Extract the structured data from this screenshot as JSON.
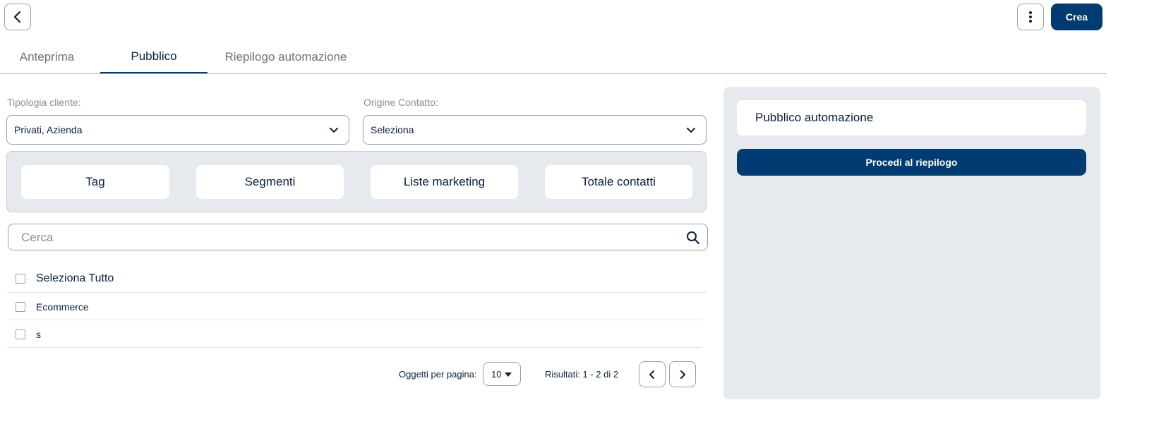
{
  "header": {
    "back_icon": "chevron-left-icon",
    "more_icon": "vertical-dots-icon",
    "create_label": "Crea"
  },
  "tabs": [
    {
      "label": "Anteprima",
      "active": false
    },
    {
      "label": "Pubblico",
      "active": true
    },
    {
      "label": "Riepilogo automazione",
      "active": false
    }
  ],
  "filters": {
    "customer_type": {
      "label": "Tipologia cliente:",
      "value": "Privati, Azienda"
    },
    "contact_origin": {
      "label": "Origine Contatto:",
      "value": "Seleziona"
    }
  },
  "audience_buttons": [
    "Tag",
    "Segmenti",
    "Liste marketing",
    "Totale contatti"
  ],
  "search": {
    "placeholder": "Cerca"
  },
  "list": {
    "select_all": "Seleziona Tutto",
    "items": [
      "Ecommerce",
      "s"
    ]
  },
  "pagination": {
    "per_page_label": "Oggetti per pagina:",
    "per_page_value": "10",
    "results": "Risultati: 1 - 2 di 2"
  },
  "side_panel": {
    "title": "Pubblico automazione",
    "proceed_label": "Procedi al riepilogo"
  },
  "colors": {
    "primary": "#003b71",
    "panel": "#e6e9ed",
    "border": "#9aa0a8"
  }
}
